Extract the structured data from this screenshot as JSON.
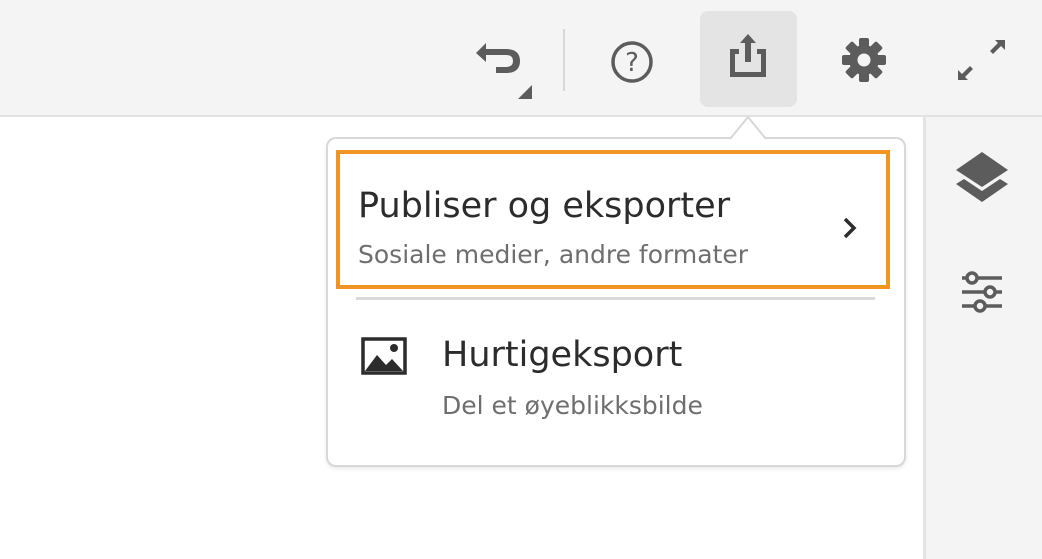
{
  "toolbar": {
    "undo_icon": "undo-icon",
    "help_icon": "help-icon",
    "share_icon": "share-export-icon",
    "settings_icon": "gear-icon",
    "fullscreen_icon": "expand-icon"
  },
  "side_panel": {
    "icons": [
      "layers-icon",
      "sliders-icon"
    ]
  },
  "menu": {
    "items": [
      {
        "title": "Publiser og eksporter",
        "subtitle": "Sosiale medier, andre formater",
        "icon": "chevron-right-icon"
      },
      {
        "title": "Hurtigeksport",
        "subtitle": "Del et øyeblikksbilde",
        "icon": "image-icon"
      }
    ]
  },
  "colors": {
    "highlight": "#f29423",
    "icon": "#5c5c5c"
  }
}
